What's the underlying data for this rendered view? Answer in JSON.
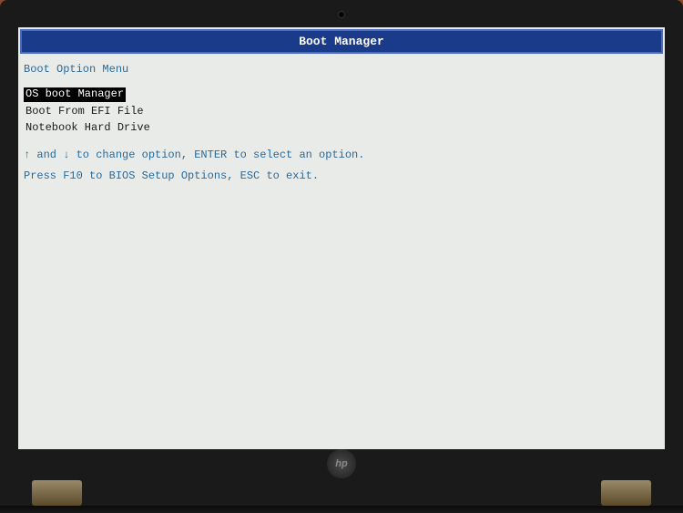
{
  "title_bar": {
    "title": "Boot Manager"
  },
  "menu": {
    "heading": "Boot Option Menu",
    "options": [
      {
        "label": "OS boot Manager",
        "selected": true
      },
      {
        "label": "Boot From EFI File",
        "selected": false
      },
      {
        "label": "Notebook Hard Drive",
        "selected": false
      }
    ]
  },
  "instructions": {
    "nav": "↑ and ↓ to change option, ENTER to select an option.",
    "exit": "Press F10 to BIOS Setup Options, ESC to exit."
  },
  "hardware": {
    "logo": "hp"
  }
}
